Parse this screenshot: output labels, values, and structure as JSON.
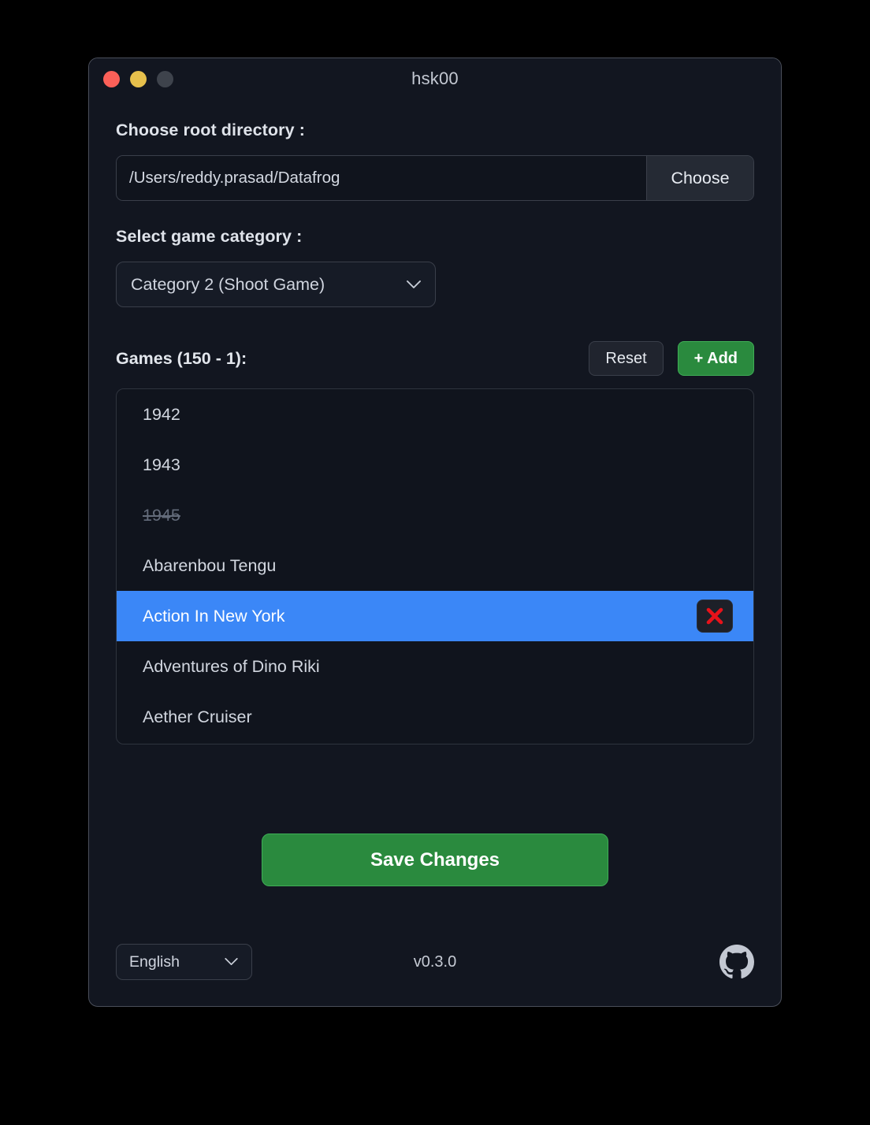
{
  "window": {
    "title": "hsk00",
    "controls": {
      "close": "close",
      "minimize": "minimize",
      "maximize": "maximize"
    }
  },
  "directory": {
    "label": "Choose root directory :",
    "path_value": "/Users/reddy.prasad/Datafrog",
    "path_placeholder": "/Users/reddy.prasad/Datafrog",
    "choose_label": "Choose"
  },
  "category": {
    "label": "Select game category :",
    "selected": "Category 2 (Shoot Game)"
  },
  "games": {
    "header": "Games (150 - 1):",
    "reset_label": "Reset",
    "add_label": "+ Add",
    "items": [
      {
        "name": "1942",
        "removed": false,
        "selected": false
      },
      {
        "name": "1943",
        "removed": false,
        "selected": false
      },
      {
        "name": "1945",
        "removed": true,
        "selected": false
      },
      {
        "name": "Abarenbou Tengu",
        "removed": false,
        "selected": false
      },
      {
        "name": "Action In New York",
        "removed": false,
        "selected": true
      },
      {
        "name": "Adventures of Dino Riki",
        "removed": false,
        "selected": false
      },
      {
        "name": "Aether Cruiser",
        "removed": false,
        "selected": false
      }
    ],
    "delete_icon": "red-x-icon"
  },
  "save": {
    "label": "Save Changes"
  },
  "footer": {
    "language": "English",
    "version": "v0.3.0",
    "github_icon": "github-icon"
  },
  "colors": {
    "accent_green": "#2a8a3e",
    "selection_blue": "#3b87f7",
    "delete_red": "#e8121a",
    "window_bg": "#121620",
    "list_bg": "#10141d"
  }
}
